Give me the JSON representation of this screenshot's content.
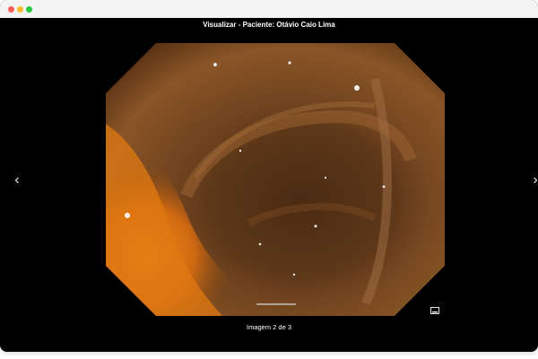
{
  "window": {
    "title": "Visualizar - Paciente: Otávio Caio Lima",
    "controls": [
      "close",
      "minimize",
      "maximize"
    ]
  },
  "viewer": {
    "prev_icon": "chevron-left-icon",
    "next_icon": "chevron-right-icon",
    "fullscreen_icon": "fullscreen-icon",
    "caption": "Imagem 2 de 3",
    "current_image": 2,
    "total_images": 3
  },
  "colors": {
    "background": "#000000",
    "titlebar": "#f4f4f4",
    "tissue_highlight": "#e07a12",
    "tissue_dark": "#4a2a12"
  }
}
